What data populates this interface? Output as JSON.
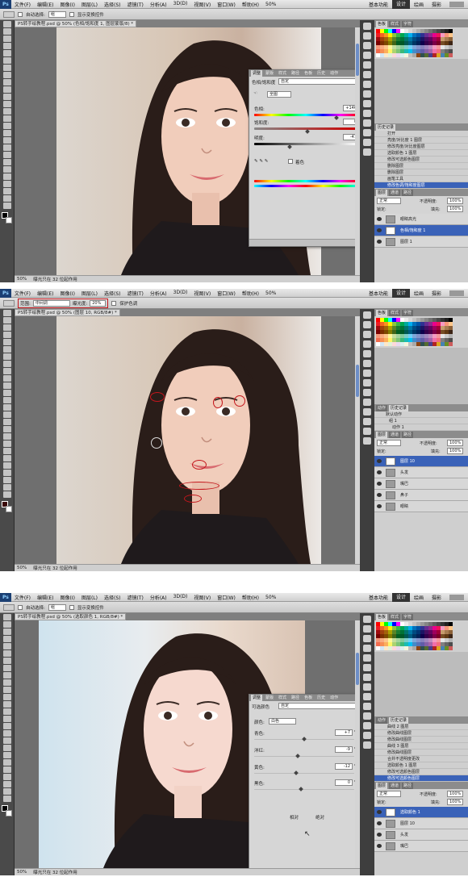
{
  "menu": [
    "文件(F)",
    "编辑(E)",
    "图像(I)",
    "图层(L)",
    "选择(S)",
    "滤镜(T)",
    "分析(A)",
    "3D(D)",
    "视图(V)",
    "窗口(W)",
    "帮助(H)"
  ],
  "zoom_menu": "50%",
  "workspaces": [
    "基本功能",
    "设计",
    "绘画",
    "摄影"
  ],
  "screens": [
    {
      "options": {
        "auto_select": "自动选择:",
        "auto_select_value": "组",
        "show_transform": "显示变换控件"
      },
      "doc_tab": "PS转手绘教程.psd @ 50% (色相/饱和度 1, 图层蒙版/8) *",
      "status_zoom": "50%",
      "status_info": "曝光只在 32 位起作用",
      "dialog": {
        "tabs": [
          "调整",
          "蒙版",
          "样式",
          "路径",
          "色板",
          "历史",
          "动作"
        ],
        "title": "色相/饱和度",
        "preset": "自定",
        "channel": "全图",
        "hue_label": "色相:",
        "hue_value": "+146",
        "sat_label": "饱和度:",
        "sat_value": "0",
        "light_label": "明度:",
        "light_value": "-41",
        "colorize": "着色"
      },
      "history": {
        "tabs": [
          "历史记录"
        ],
        "items": [
          "打开",
          "亮度/对比度 1 图层",
          "修改亮度/对比度图层",
          "选取颜色 1 图层",
          "修改可选颜色图层",
          "删除图层",
          "删除图层",
          "画笔工具",
          "修改色调/饱和度图层"
        ],
        "selected": 8
      },
      "layers": {
        "tabs": [
          "图层",
          "通道",
          "路径"
        ],
        "blend": "正常",
        "opacity_label": "不透明度:",
        "opacity": "100%",
        "lock_label": "锁定:",
        "fill_label": "填充:",
        "fill": "100%",
        "items": [
          "眼睛高光",
          "色相/饱和度 1",
          "图层 1"
        ],
        "selected": 1
      }
    },
    {
      "options": {
        "range_label": "范围:",
        "range_value": "中间调",
        "exposure_label": "曝光度:",
        "exposure_value": "20%",
        "protect": "保护色调"
      },
      "doc_tab": "PS转手绘教程.psd @ 50% (图层 10, RGB/8#) *",
      "status_zoom": "50%",
      "status_info": "曝光只在 32 位起作用",
      "actions": {
        "tabs": [
          "动作",
          "历史记录"
        ],
        "items": [
          "默认动作",
          "组 1",
          "动作 1"
        ]
      },
      "layers": {
        "tabs": [
          "图层",
          "通道",
          "路径"
        ],
        "blend": "正常",
        "opacity_label": "不透明度:",
        "opacity": "100%",
        "lock_label": "锁定:",
        "fill_label": "填充:",
        "fill": "100%",
        "items": [
          "图层 10",
          "头发",
          "嘴巴",
          "鼻子",
          "眼睛"
        ],
        "selected": 0
      }
    },
    {
      "options": {
        "auto_select": "自动选择:",
        "auto_select_value": "组",
        "show_transform": "显示变换控件"
      },
      "doc_tab": "PS转手绘教程.psd @ 50% (选取颜色 1, RGB/8#) *",
      "status_zoom": "50%",
      "status_info": "曝光只在 32 位起作用",
      "dialog": {
        "tabs": [
          "调整",
          "蒙版",
          "样式",
          "路径",
          "色板",
          "历史",
          "动作"
        ],
        "title": "可选颜色",
        "preset": "自定",
        "color_label": "颜色:",
        "color_value": "白色",
        "cyan_label": "青色:",
        "cyan_value": "+7",
        "magenta_label": "洋红:",
        "magenta_value": "-9",
        "yellow_label": "黄色:",
        "yellow_value": "-12",
        "black_label": "黑色:",
        "black_value": "0",
        "pct": "%",
        "relative": "相对",
        "absolute": "绝对"
      },
      "history": {
        "tabs": [
          "动作",
          "历史记录"
        ],
        "items": [
          "曲线 2 图层",
          "修改曲线图层",
          "修改曲线图层",
          "曲线 3 图层",
          "修改曲线图层",
          "合并不透明度更改",
          "选取颜色 1 图层",
          "修改可选颜色图层",
          "修改可选颜色图层"
        ],
        "selected": 8
      },
      "layers": {
        "tabs": [
          "图层",
          "通道",
          "路径"
        ],
        "blend": "正常",
        "opacity_label": "不透明度:",
        "opacity": "100%",
        "lock_label": "锁定:",
        "fill_label": "填充:",
        "fill": "100%",
        "items": [
          "选取颜色 1",
          "图层 10",
          "头发",
          "嘴巴"
        ],
        "selected": 0
      }
    }
  ]
}
